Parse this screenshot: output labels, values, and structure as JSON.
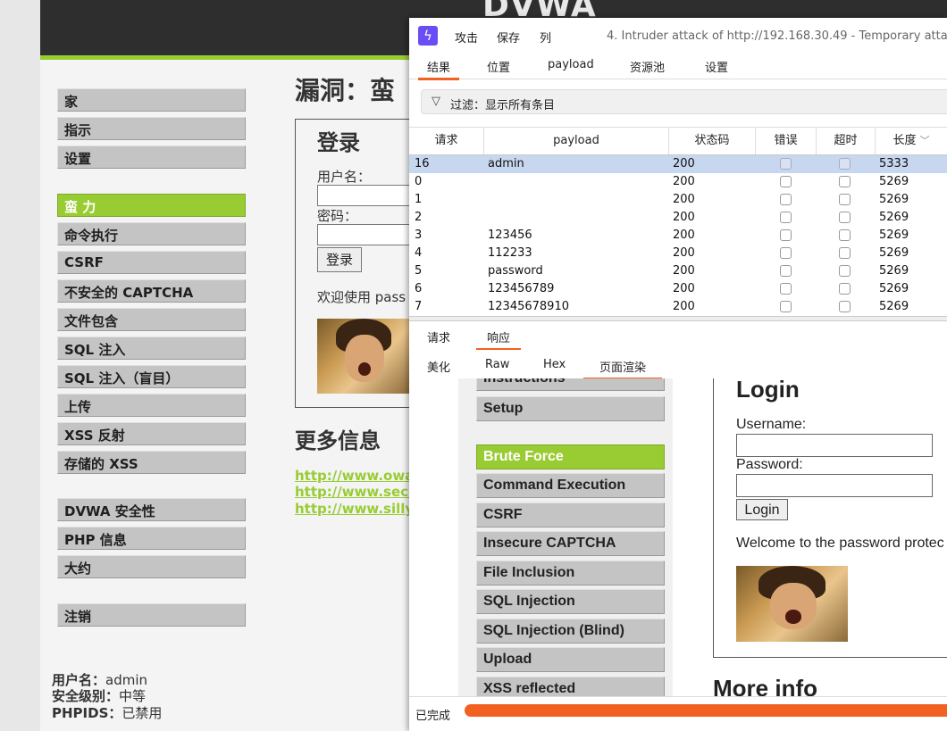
{
  "dvwa": {
    "logo": "DVWA",
    "nav_group1": [
      "家",
      "指示",
      "设置"
    ],
    "nav_group2": [
      "蛮 力",
      "命令执行",
      "CSRF",
      "不安全的 CAPTCHA",
      "文件包含",
      "SQL 注入",
      "SQL 注入（盲目）",
      "上传",
      "XSS 反射",
      "存储的 XSS"
    ],
    "nav_group3": [
      "DVWA 安全性",
      "PHP 信息",
      "大约"
    ],
    "nav_group4": [
      "注销"
    ],
    "page_title": "漏洞：蛮",
    "login_heading": "登录",
    "username_label": "用户名：",
    "password_label": "密码：",
    "login_button": "登录",
    "welcome_text": "欢迎使用 pass",
    "more_info": "更多信息",
    "links": [
      "http://www.owasp",
      "http://www.secur",
      "http://www.sillyc"
    ],
    "footer": {
      "user_label": "用户名：",
      "user_value": "admin",
      "security_label": "安全级别：",
      "security_value": "中等",
      "phpids_label": "PHPIDS：",
      "phpids_value": "已禁用"
    }
  },
  "burp": {
    "menu": [
      "攻击",
      "保存",
      "列"
    ],
    "window_title": "4. Intruder attack of http://192.168.30.49 - Temporary atta",
    "tabs": [
      "结果",
      "位置",
      "payload",
      "资源池",
      "设置"
    ],
    "filter_text": "过滤：显示所有条目",
    "columns": [
      "请求",
      "payload",
      "状态码",
      "错误",
      "超时",
      "长度"
    ],
    "rows": [
      {
        "req": "16",
        "payload": "admin",
        "status": "200",
        "length": "5333"
      },
      {
        "req": "0",
        "payload": "",
        "status": "200",
        "length": "5269"
      },
      {
        "req": "1",
        "payload": "",
        "status": "200",
        "length": "5269"
      },
      {
        "req": "2",
        "payload": "",
        "status": "200",
        "length": "5269"
      },
      {
        "req": "3",
        "payload": "123456",
        "status": "200",
        "length": "5269"
      },
      {
        "req": "4",
        "payload": "112233",
        "status": "200",
        "length": "5269"
      },
      {
        "req": "5",
        "payload": "password",
        "status": "200",
        "length": "5269"
      },
      {
        "req": "6",
        "payload": "123456789",
        "status": "200",
        "length": "5269"
      },
      {
        "req": "7",
        "payload": "12345678910",
        "status": "200",
        "length": "5269"
      }
    ],
    "detail_tabs": [
      "请求",
      "响应"
    ],
    "view_tabs": [
      "美化",
      "Raw",
      "Hex",
      "页面渲染"
    ],
    "render": {
      "nav_top": [
        "Instructions",
        "Setup"
      ],
      "nav": [
        "Brute Force",
        "Command Execution",
        "CSRF",
        "Insecure CAPTCHA",
        "File Inclusion",
        "SQL Injection",
        "SQL Injection (Blind)",
        "Upload",
        "XSS reflected"
      ],
      "login_heading": "Login",
      "username_label": "Username:",
      "password_label": "Password:",
      "login_button": "Login",
      "welcome_text": "Welcome to the password protec",
      "more_info": "More info"
    },
    "status_text": "已完成",
    "progress_percent": 100
  },
  "colors": {
    "accent_green": "#99cc33",
    "burp_orange": "#f26122",
    "burp_purple": "#6a4df4",
    "selected_row": "#c7d7ef"
  }
}
